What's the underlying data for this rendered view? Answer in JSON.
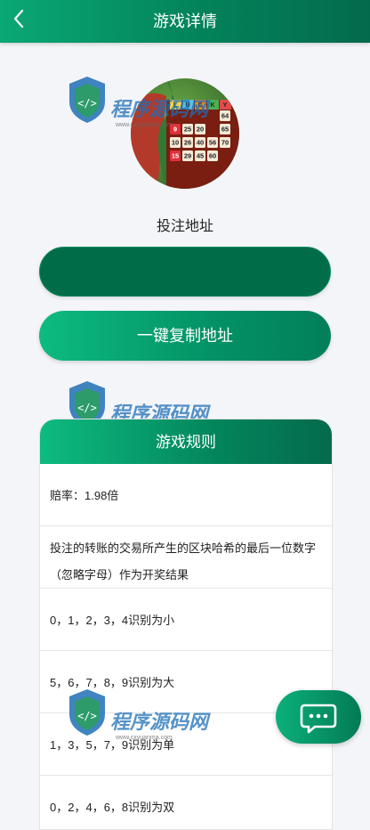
{
  "header": {
    "title": "游戏详情",
    "back_icon": "chevron-left-icon"
  },
  "game": {
    "logo_text": "LUCKY",
    "numbers": [
      "64",
      "65",
      "9",
      "25",
      "20",
      "10",
      "26",
      "40",
      "56",
      "70",
      "15",
      "29",
      "45",
      "60"
    ]
  },
  "address": {
    "label": "投注地址",
    "value": ""
  },
  "copy_button": {
    "label": "一键复制地址"
  },
  "rules": {
    "title": "游戏规则",
    "items": [
      "赔率：1.98倍",
      "投注的转账的交易所产生的区块哈希的最后一位数字（忽略字母）作为开奖结果",
      "0，1，2，3，4识别为小",
      "5，6，7，8，9识别为大",
      "1，3，5，7，9识别为单",
      "0，2，4，6，8识别为双"
    ]
  },
  "watermark": {
    "brand": "程序源码网",
    "url": "www.cxyuanma.com"
  },
  "chat_button": {
    "icon": "chat-bubble-icon"
  },
  "colors": {
    "primary": "#03825a",
    "accent": "#0dbb80",
    "dark": "#006c48"
  }
}
